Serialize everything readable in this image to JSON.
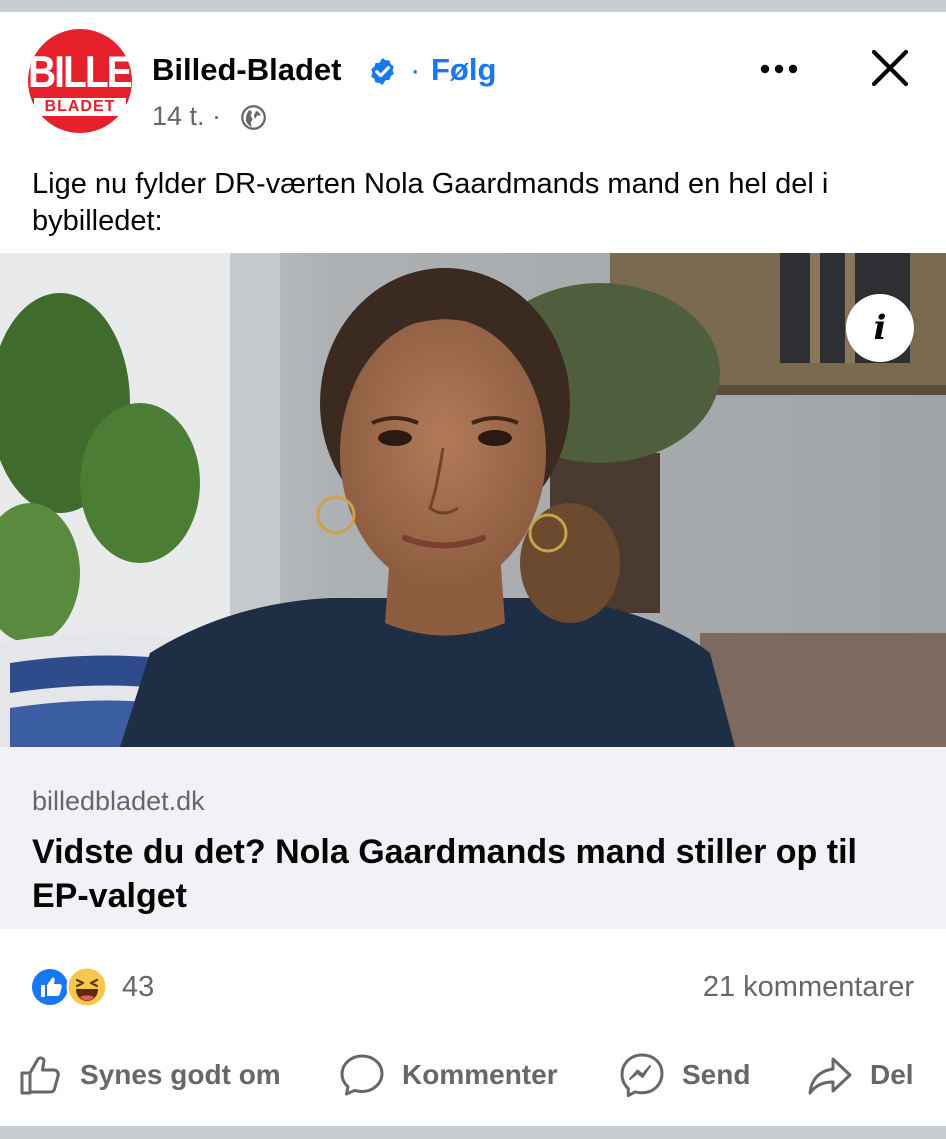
{
  "post": {
    "page_name": "Billed-Bladet",
    "follow_label": "Følg",
    "separator": "·",
    "timestamp": "14 t. ·",
    "logo": {
      "top_text": "BILLED",
      "bottom_text": "BLADET",
      "icon": "billed-bladet-logo"
    },
    "text": "Lige nu fylder DR-værten Nola Gaardmands mand en hel del i bybilledet:",
    "image_info_label": "i"
  },
  "link_preview": {
    "domain": "billedbladet.dk",
    "title": "Vidste du det? Nola Gaardmands mand stiller op til EP-valget"
  },
  "reactions": {
    "count": "43",
    "types": [
      "like",
      "haha"
    ],
    "comments": "21 kommentarer"
  },
  "actions": {
    "like": "Synes godt om",
    "comment": "Kommenter",
    "send": "Send",
    "share": "Del"
  },
  "colors": {
    "brand_blue": "#1877f2",
    "secondary_text": "#65676b",
    "logo_red": "#e5202a",
    "link_bg": "#f0f2f5"
  }
}
